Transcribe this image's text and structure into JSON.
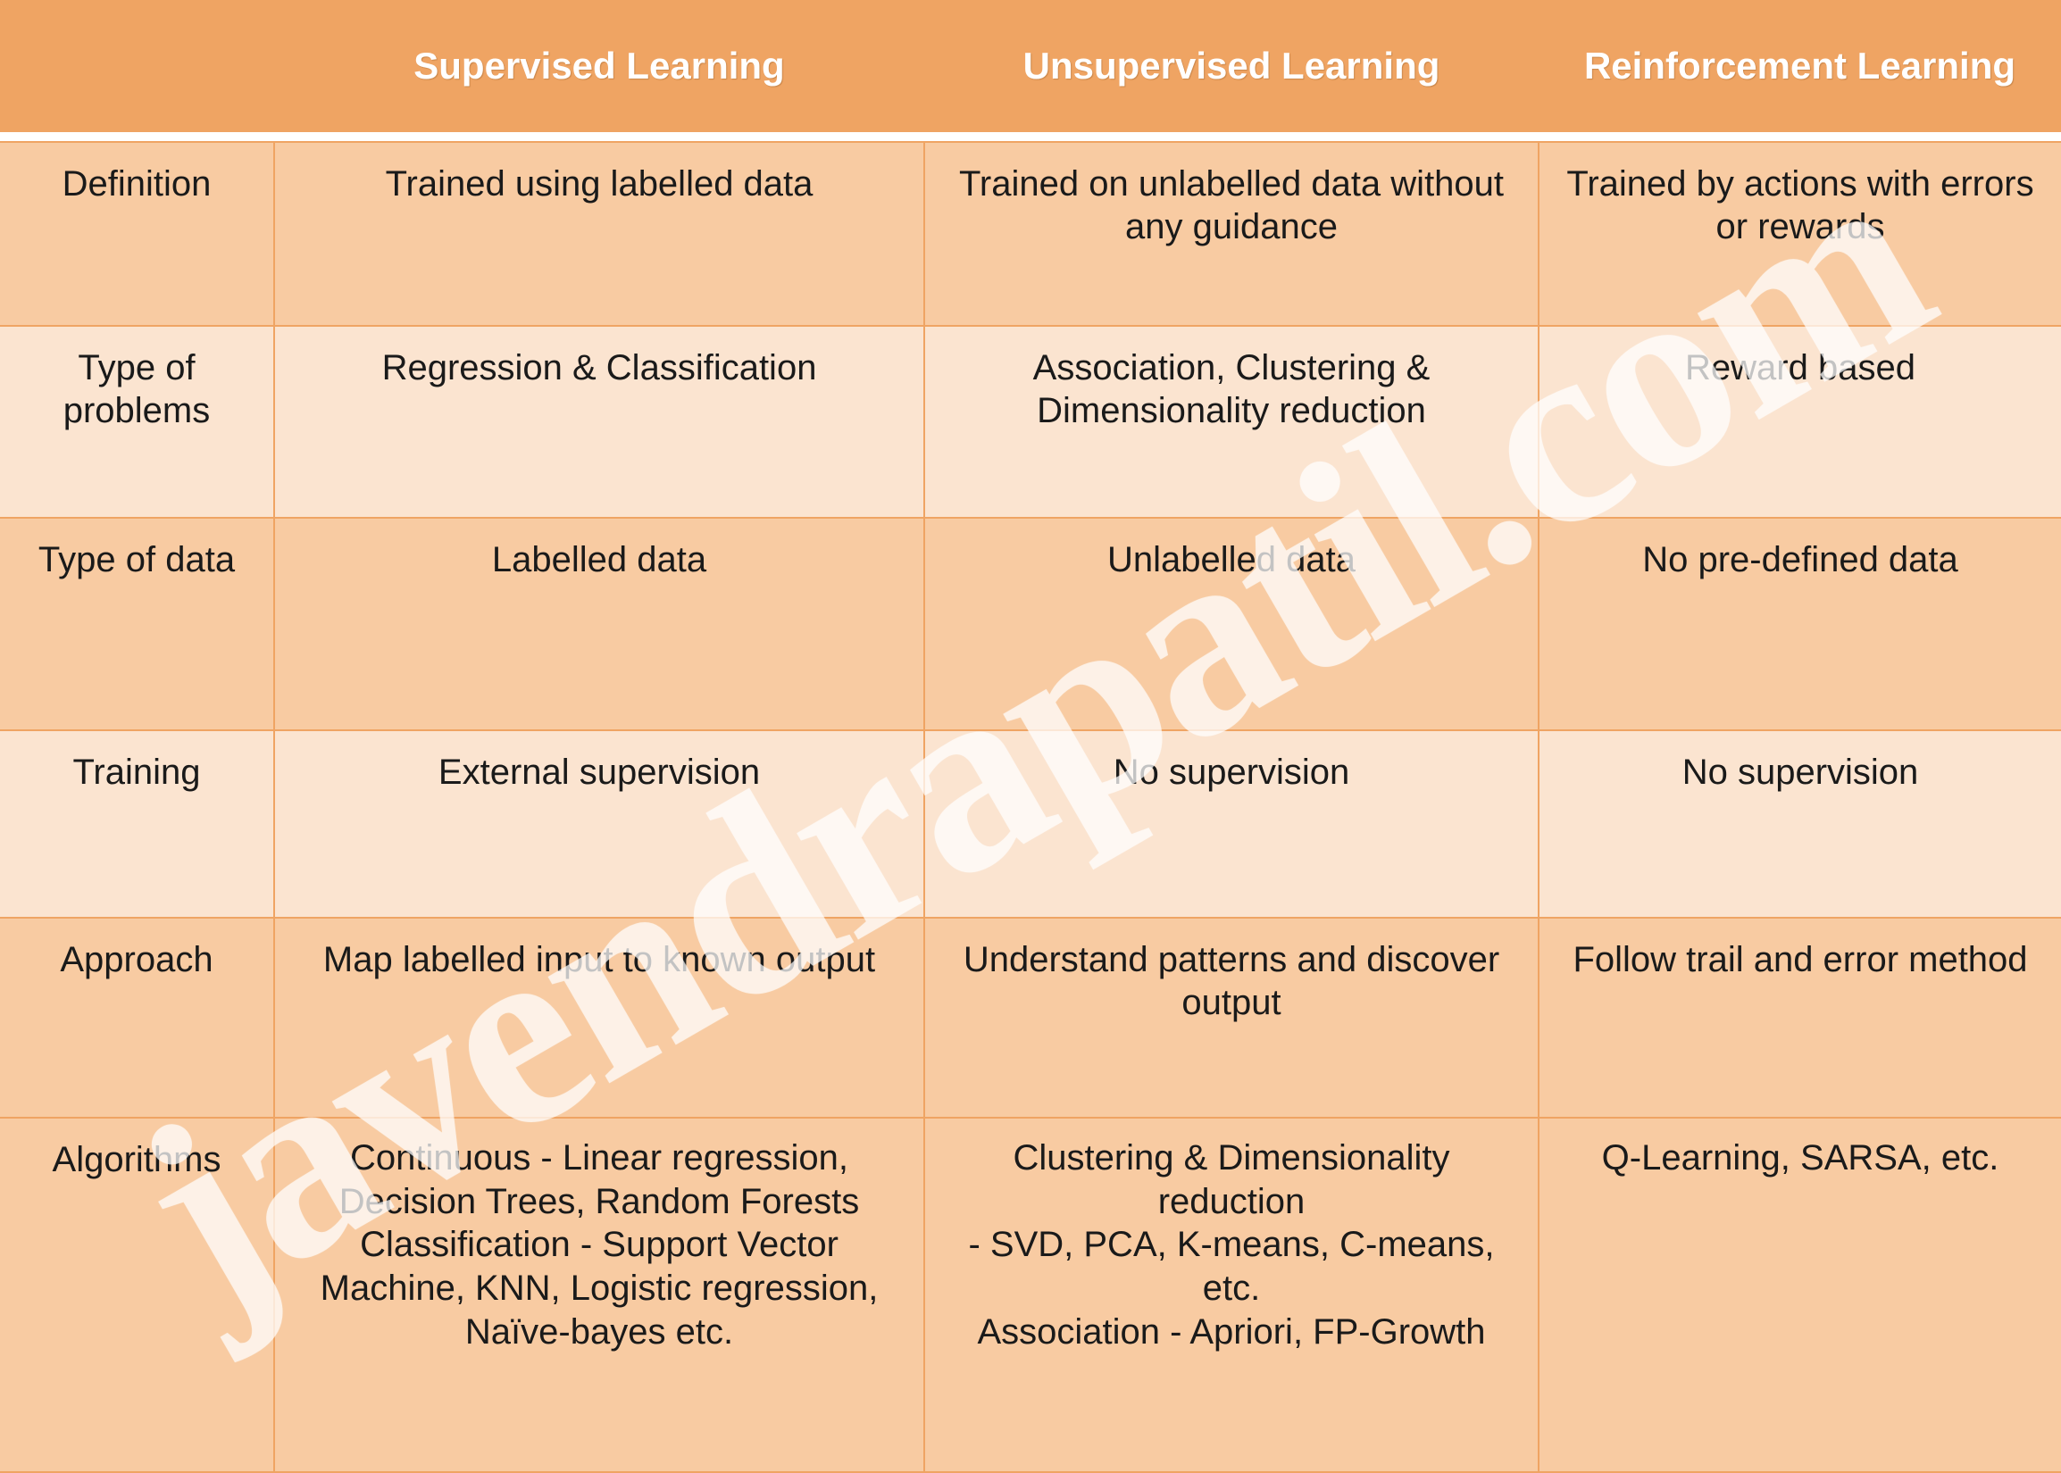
{
  "table": {
    "headers": [
      {
        "label": ""
      },
      {
        "label": "Supervised Learning"
      },
      {
        "label": "Unsupervised Learning"
      },
      {
        "label": "Reinforcement Learning"
      }
    ],
    "rows": [
      {
        "attribute": "Definition",
        "supervised": "Trained using labelled data",
        "unsupervised": "Trained on unlabelled data without any guidance",
        "reinforcement": "Trained by actions with errors or rewards"
      },
      {
        "attribute": "Type of problems",
        "supervised": "Regression & Classification",
        "unsupervised": "Association, Clustering & Dimensionality reduction",
        "reinforcement": "Reward based"
      },
      {
        "attribute": "Type of data",
        "supervised": "Labelled data",
        "unsupervised": "Unlabelled data",
        "reinforcement": "No pre-defined data"
      },
      {
        "attribute": "Training",
        "supervised": "External supervision",
        "unsupervised": "No supervision",
        "reinforcement": "No supervision"
      },
      {
        "attribute": "Approach",
        "supervised": "Map labelled input to known output",
        "unsupervised": "Understand patterns and discover output",
        "reinforcement": "Follow trail and error method"
      },
      {
        "attribute": "Algorithms",
        "supervised": "Continuous - Linear regression, Decision Trees, Random Forests\nClassification - Support Vector Machine, KNN, Logistic regression, Naïve-bayes etc.",
        "unsupervised": "Clustering & Dimensionality reduction\n- SVD, PCA, K-means, C-means, etc.\nAssociation - Apriori, FP-Growth",
        "reinforcement": "Q-Learning, SARSA, etc."
      }
    ]
  },
  "watermark": {
    "text": "javendrapatil.com"
  },
  "colors": {
    "header_background": "#EFA463",
    "header_text": "#FFFFFF",
    "row_dark": "#F8CBA2",
    "row_light": "#FBE4D0",
    "border": "#EFA463",
    "body_text": "#1A1A1A",
    "page_background": "#FFFFFF"
  }
}
